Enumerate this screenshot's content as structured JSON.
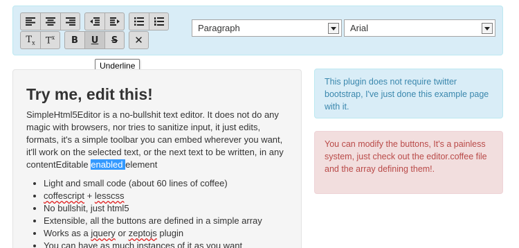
{
  "toolbar": {
    "align_group": [
      "align-left",
      "align-center",
      "align-right"
    ],
    "indent_group": [
      "outdent",
      "indent"
    ],
    "list_group": [
      "bullet-list",
      "numbered-list"
    ],
    "subscript_label": "T",
    "subscript_mark": "x",
    "superscript_label": "T",
    "superscript_mark": "x",
    "bold_label": "B",
    "underline_label": "U",
    "strike_label": "S",
    "clear_label": "✕",
    "block_select_value": "Paragraph",
    "font_select_value": "Arial",
    "tooltip": "Underline"
  },
  "editor": {
    "heading": "Try me, edit this!",
    "para_before": "SimpleHtml5Editor is a no-bullshit text editor. It does not do any magic with browsers, nor tries to sanitize input, it just edits, formats, it's a simple toolbar you can embed wherever you want, it'll work on the selected text, or the next text to be written, in any contentEditable ",
    "para_selected": "enabled ",
    "para_after": "element",
    "items": [
      "Light and small code (about 60 lines of coffee)",
      "coffescript + lesscss",
      "No bullshit, just html5",
      "Extensible, all the buttons are defined in a simple array",
      "Works as a jquery or zeptojs plugin",
      "You can have as much instances of it as you want"
    ],
    "item2_a": "coffescript",
    "item2_b": " + ",
    "item2_c": "lesscss",
    "item5_a": "Works as a ",
    "item5_b": "jquery",
    "item5_c": " or ",
    "item5_d": "zeptojs",
    "item5_e": " plugin"
  },
  "alerts": {
    "info": "This plugin does not require twitter bootstrap, I've just done this example page with it.",
    "error": "You can modify the buttons, It's a painless system, just check out the editor.coffee file and the array defining them!."
  },
  "colors": {
    "info_bg": "#d9edf7",
    "info_text": "#3a87ad",
    "error_bg": "#f2dede",
    "error_text": "#b94a48",
    "selection": "#3399ff"
  }
}
